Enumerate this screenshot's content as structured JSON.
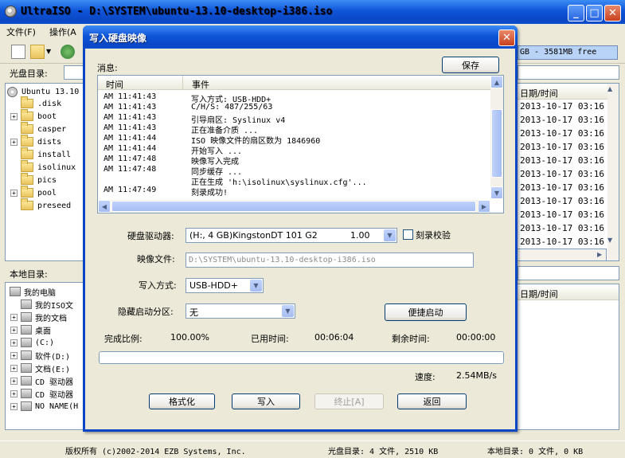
{
  "window": {
    "title": "UltraISO - D:\\SYSTEM\\ubuntu-13.10-desktop-i386.iso",
    "menus": [
      "文件(F)",
      "操作(A"
    ]
  },
  "toolbar": {
    "free_space": "GB - 3581MB free"
  },
  "cd_panel": {
    "label": "光盘目录:",
    "tree": [
      {
        "name": "Ubuntu 13.10",
        "expander": ""
      },
      {
        "name": ".disk",
        "expander": ""
      },
      {
        "name": "boot",
        "expander": "+"
      },
      {
        "name": "casper",
        "expander": ""
      },
      {
        "name": "dists",
        "expander": "+"
      },
      {
        "name": "install",
        "expander": ""
      },
      {
        "name": "isolinux",
        "expander": ""
      },
      {
        "name": "pics",
        "expander": ""
      },
      {
        "name": "pool",
        "expander": "+"
      },
      {
        "name": "preseed",
        "expander": ""
      }
    ],
    "date_header": "日期/时间",
    "dates": [
      "2013-10-17 03:16",
      "2013-10-17 03:16",
      "2013-10-17 03:16",
      "2013-10-17 03:16",
      "2013-10-17 03:16",
      "2013-10-17 03:16",
      "2013-10-17 03:16",
      "2013-10-17 03:16",
      "2013-10-17 03:16",
      "2013-10-17 03:16",
      "2013-10-17 03:16"
    ]
  },
  "local_panel": {
    "label": "本地目录:",
    "tree": [
      {
        "name": "我的电脑",
        "expander": ""
      },
      {
        "name": "我的ISO文",
        "expander": ""
      },
      {
        "name": "我的文档",
        "expander": "+"
      },
      {
        "name": "桌面",
        "expander": "+"
      },
      {
        "name": "(C:)",
        "expander": "+"
      },
      {
        "name": "软件(D:)",
        "expander": "+"
      },
      {
        "name": "文档(E:)",
        "expander": "+"
      },
      {
        "name": "CD 驱动器",
        "expander": "+"
      },
      {
        "name": "CD 驱动器",
        "expander": "+"
      },
      {
        "name": "NO NAME(H",
        "expander": "+"
      }
    ],
    "date_header": "日期/时间"
  },
  "status": {
    "copyright": "版权所有 (c)2002-2014 EZB Systems, Inc.",
    "cd_dir": "光盘目录: 4 文件, 2510 KB",
    "local_dir": "本地目录: 0 文件, 0 KB"
  },
  "dialog": {
    "title": "写入硬盘映像",
    "message_label": "消息:",
    "save_label": "保存",
    "log_columns": [
      "时间",
      "事件"
    ],
    "log": [
      {
        "time": "AM 11:41:43",
        "event": "写入方式: USB-HDD+"
      },
      {
        "time": "AM 11:41:43",
        "event": "C/H/S: 487/255/63"
      },
      {
        "time": "AM 11:41:43",
        "event": "引导扇区: Syslinux v4"
      },
      {
        "time": "AM 11:41:43",
        "event": "正在准备介质 ..."
      },
      {
        "time": "AM 11:41:44",
        "event": "ISO 映像文件的扇区数为 1846960"
      },
      {
        "time": "AM 11:41:44",
        "event": "开始写入 ..."
      },
      {
        "time": "AM 11:47:48",
        "event": "映像写入完成"
      },
      {
        "time": "AM 11:47:48",
        "event": "同步缓存 ..."
      },
      {
        "time": "",
        "event": "正在生成 'h:\\isolinux\\syslinux.cfg'..."
      },
      {
        "time": "AM 11:47:49",
        "event": "刻录成功!"
      }
    ],
    "drive_label": "硬盘驱动器:",
    "drive_value": "(H:, 4 GB)KingstonDT 101 G2",
    "drive_version": "1.00",
    "verify_label": "刻录校验",
    "image_label": "映像文件:",
    "image_value": "D:\\SYSTEM\\ubuntu-13.10-desktop-i386.iso",
    "write_mode_label": "写入方式:",
    "write_mode_value": "USB-HDD+",
    "hidden_label": "隐藏启动分区:",
    "hidden_value": "无",
    "quick_boot_label": "便捷启动",
    "progress_label": "完成比例:",
    "progress_value": "100.00%",
    "progress_fraction": 1.0,
    "elapsed_label": "已用时间:",
    "elapsed_value": "00:06:04",
    "remaining_label": "剩余时间:",
    "remaining_value": "00:00:00",
    "speed_label": "速度:",
    "speed_value": "2.54MB/s",
    "buttons": {
      "format": "格式化",
      "write": "写入",
      "abort": "终止[A]",
      "back": "返回"
    }
  }
}
